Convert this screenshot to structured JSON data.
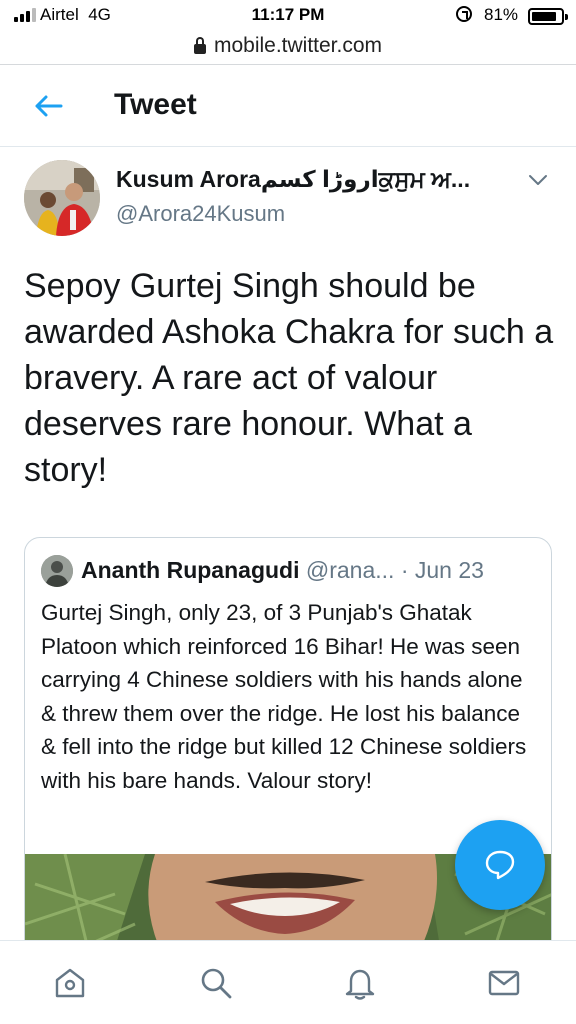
{
  "status_bar": {
    "carrier": "Airtel",
    "network": "4G",
    "time": "11:17 PM",
    "battery_percent": "81%",
    "signal_bars": 3
  },
  "browser": {
    "url": "mobile.twitter.com"
  },
  "header": {
    "back_icon": "back-arrow-icon",
    "title": "Tweet"
  },
  "tweet": {
    "author_name": "Kusum Aroraاروڑا کسمਕੁਸੁਮ ਅ...",
    "author_handle": "@Arora24Kusum",
    "text": "Sepoy Gurtej Singh should be awarded Ashoka Chakra for such a bravery. A rare act of valour deserves rare honour. What a story!",
    "menu_icon": "chevron-down-icon"
  },
  "quoted_tweet": {
    "author_name": "Ananth Rupanagudi",
    "author_handle": "@rana...",
    "separator": "·",
    "date": "Jun 23",
    "text": "Gurtej Singh, only 23, of 3 Punjab's Ghatak Platoon which reinforced 16 Bihar! He was seen carrying 4 Chinese soldiers with his hands alone & threw them over the ridge. He lost his balance & fell into the ridge but killed 12 Chinese soldiers with his bare hands. Valour story!"
  },
  "fab": {
    "icon": "compose-reply-icon"
  },
  "bottom_nav": {
    "items": [
      {
        "icon": "home-icon"
      },
      {
        "icon": "search-icon"
      },
      {
        "icon": "notifications-bell-icon"
      },
      {
        "icon": "messages-envelope-icon"
      }
    ]
  },
  "colors": {
    "accent": "#1da1f2",
    "text_primary": "#14171a",
    "text_secondary": "#657786",
    "border": "#ccd6dd"
  }
}
